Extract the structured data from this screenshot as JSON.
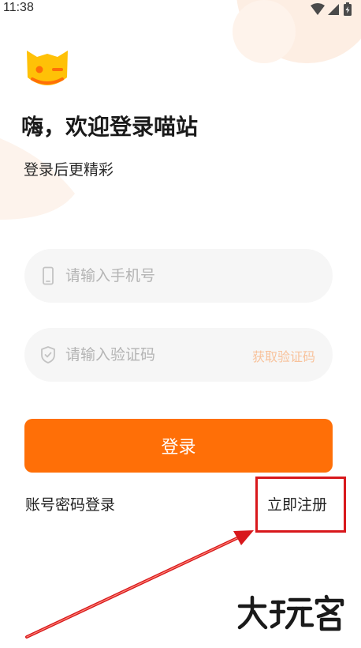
{
  "status_bar": {
    "time": "11:38",
    "icons": [
      "wifi-icon",
      "cellular-signal-icon",
      "battery-charging-icon"
    ]
  },
  "app": {
    "logo": "cat-logo-icon"
  },
  "welcome": {
    "title": "嗨，欢迎登录喵站",
    "subtitle": "登录后更精彩"
  },
  "form": {
    "phone": {
      "placeholder": "请输入手机号",
      "value": "",
      "icon": "phone-icon"
    },
    "code": {
      "placeholder": "请输入验证码",
      "value": "",
      "icon": "shield-icon",
      "get_code_label": "获取验证码"
    },
    "login_label": "登录",
    "password_login_label": "账号密码登录",
    "register_label": "立即注册"
  },
  "watermark": "大玩客",
  "colors": {
    "accent": "#ff6f07",
    "get_code_text": "#f8c29b",
    "decoration": "#fde9dc",
    "annotation": "#d8181c"
  }
}
